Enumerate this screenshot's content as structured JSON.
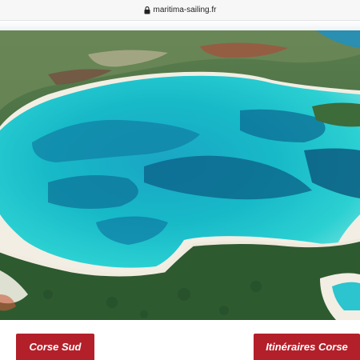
{
  "browser": {
    "url": "maritima-sailing.fr",
    "lock_icon": "lock-icon"
  },
  "hero": {
    "image": "aerial-bay-lagoon",
    "colors": {
      "lagoon": "#19b8c6",
      "deep_water": "#0b5f86",
      "sand": "#f3efe6",
      "vegetation": "#2f6e3e"
    }
  },
  "buttons": {
    "left_label": "Corse Sud",
    "right_label": "Itinéraires Corse",
    "color": "#b3202a"
  }
}
